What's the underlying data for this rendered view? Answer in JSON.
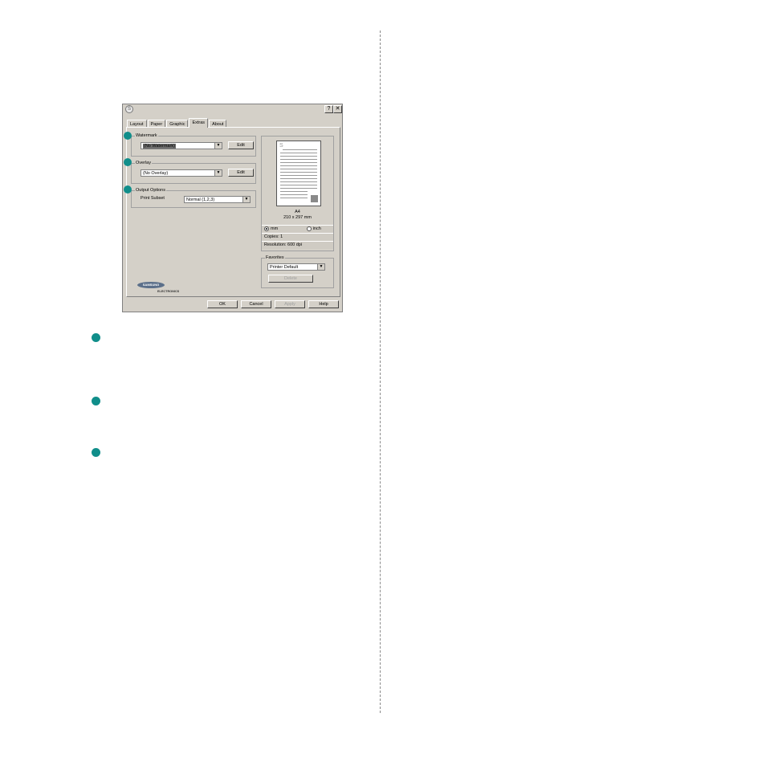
{
  "dialog": {
    "title_icon": "S",
    "help_button": "?",
    "close_button": "✕",
    "tabs": [
      "Layout",
      "Paper",
      "Graphic",
      "Extras",
      "About"
    ],
    "active_tab": "Extras",
    "watermark": {
      "legend": "Watermark",
      "selected": "(No Watermark)",
      "edit_label": "Edit"
    },
    "overlay": {
      "legend": "Overlay",
      "selected": "(No Overlay)",
      "edit_label": "Edit"
    },
    "output_options": {
      "legend": "Output Options",
      "print_subset_label": "Print Subset",
      "print_subset_value": "Normal (1,2,3)"
    },
    "preview": {
      "paper_name": "A4",
      "paper_size": "210 x 297 mm",
      "unit_mm": "mm",
      "unit_inch": "inch",
      "selected_unit": "mm",
      "copies": "Copies: 1",
      "resolution": "Resolution: 600 dpi",
      "page_letter": "S"
    },
    "favorites": {
      "legend": "Favorites",
      "selected": "Printer Default",
      "delete_label": "Delete"
    },
    "logo": {
      "brand": "SAMSUNG",
      "sub": "ELECTRONICS"
    },
    "buttons": {
      "ok": "OK",
      "cancel": "Cancel",
      "apply": "Apply",
      "help": "Help"
    }
  },
  "markers": {
    "color": "#108e8a"
  }
}
